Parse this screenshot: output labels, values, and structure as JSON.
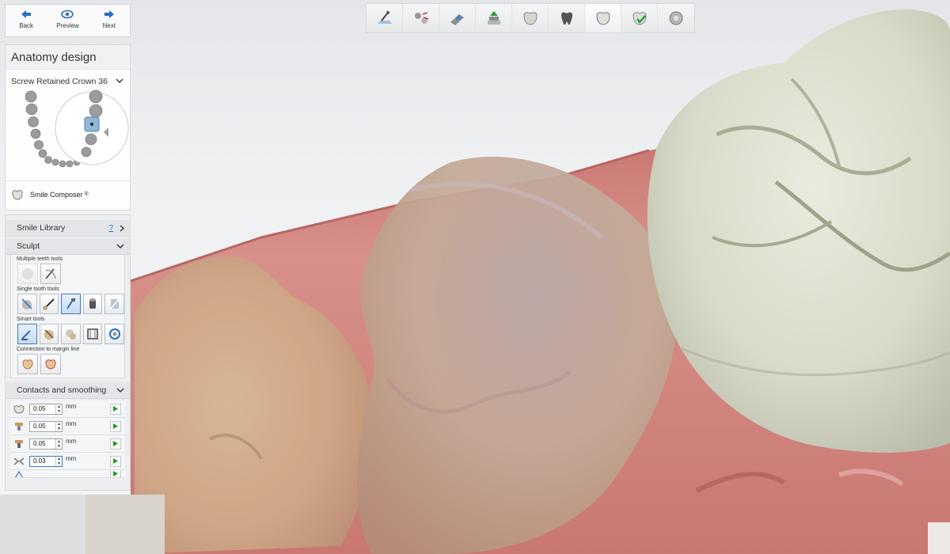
{
  "nav": {
    "back_label": "Back",
    "preview_label": "Preview",
    "next_label": "Next"
  },
  "toolbar": {
    "buttons": [
      "prepare-scan-icon",
      "margin-line-icon",
      "insertion-direction-icon",
      "abutment-icon",
      "crown-icon",
      "tooth-gray-icon",
      "anatomy-tooth-icon",
      "tooth-check-icon",
      "finish-disk-icon"
    ]
  },
  "panel": {
    "title": "Anatomy design",
    "crown_select": "Screw Retained Crown 36",
    "smile_composer": "Smile Composer",
    "smile_composer_mark": "®"
  },
  "tools": {
    "smile_library": "Smile Library",
    "help_mark": "?",
    "sculpt": "Sculpt",
    "multiple_teeth_tools": "Multiple teeth tools",
    "single_tooth_tools": "Single tooth tools",
    "smart_tools": "Smart tools",
    "connection_to_margin_line": "Connection to margin line",
    "contacts_and_smoothing": "Contacts and smoothing"
  },
  "params": [
    {
      "value": "0.05",
      "unit": "mm"
    },
    {
      "value": "0.05",
      "unit": "mm"
    },
    {
      "value": "0.05",
      "unit": "mm"
    },
    {
      "value": "0.03",
      "unit": "mm"
    }
  ],
  "colors": {
    "accent": "#2a6ec2",
    "play_green": "#1e9e2a",
    "gum": "#d98983",
    "crown": "#dde0d0"
  }
}
